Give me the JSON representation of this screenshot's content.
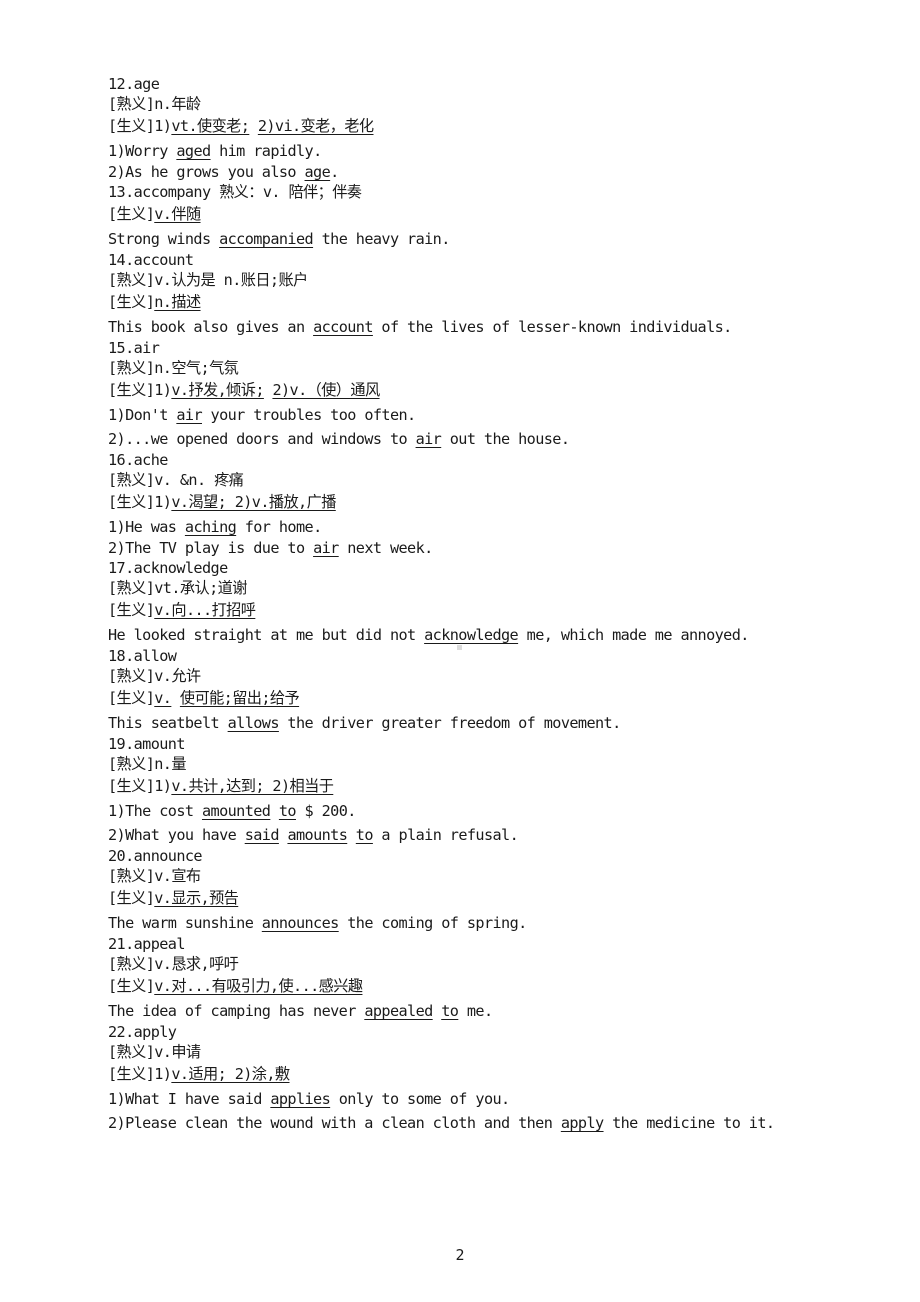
{
  "document": {
    "page_number": "2",
    "lines": [
      {
        "type": "head",
        "segs": [
          {
            "t": "12.age"
          }
        ]
      },
      {
        "type": "head",
        "segs": [
          {
            "t": "[熟义]n.年龄"
          }
        ]
      },
      {
        "type": "gloss",
        "segs": [
          {
            "t": "[生义]1)"
          },
          {
            "t": "vt.使变老;",
            "u": true
          },
          {
            "t": " "
          },
          {
            "t": "2)vi.变老，老化",
            "u": true
          }
        ]
      },
      {
        "type": "sent",
        "segs": [
          {
            "t": "1)Worry "
          },
          {
            "t": "aged",
            "u": true
          },
          {
            "t": " him rapidly."
          }
        ]
      },
      {
        "type": "head",
        "segs": [
          {
            "t": "2)As he grows you also "
          },
          {
            "t": "age",
            "u": true
          },
          {
            "t": "."
          }
        ]
      },
      {
        "type": "head",
        "segs": [
          {
            "t": "13.accompany 熟义：v. 陪伴；伴奏"
          }
        ]
      },
      {
        "type": "gloss",
        "segs": [
          {
            "t": "[生义]"
          },
          {
            "t": "v.伴随",
            "u": true
          }
        ]
      },
      {
        "type": "sent",
        "segs": [
          {
            "t": "Strong winds "
          },
          {
            "t": "accompanied",
            "u": true
          },
          {
            "t": " the heavy rain."
          }
        ]
      },
      {
        "type": "head",
        "segs": [
          {
            "t": "14.account"
          }
        ]
      },
      {
        "type": "head",
        "segs": [
          {
            "t": "[熟义]v.认为是 n.账日;账户"
          }
        ]
      },
      {
        "type": "gloss",
        "segs": [
          {
            "t": "[生义]"
          },
          {
            "t": "n.描述",
            "u": true
          }
        ]
      },
      {
        "type": "sent",
        "segs": [
          {
            "t": "This book also gives an "
          },
          {
            "t": "account",
            "u": true
          },
          {
            "t": " of the lives of lesser-known individuals."
          }
        ]
      },
      {
        "type": "head",
        "segs": [
          {
            "t": "15.air"
          }
        ]
      },
      {
        "type": "head",
        "segs": [
          {
            "t": "[熟义]n.空气;气氛"
          }
        ]
      },
      {
        "type": "gloss",
        "segs": [
          {
            "t": "[生义]1)"
          },
          {
            "t": "v.抒发,倾诉;",
            "u": true
          },
          {
            "t": " "
          },
          {
            "t": "2)v.（使）通风",
            "u": true
          }
        ]
      },
      {
        "type": "sent",
        "segs": [
          {
            "t": "1)Don't "
          },
          {
            "t": "air",
            "u": true
          },
          {
            "t": " your troubles too often."
          }
        ]
      },
      {
        "type": "sent",
        "segs": [
          {
            "t": "2)...we opened doors and windows to "
          },
          {
            "t": "air",
            "u": true
          },
          {
            "t": " out the house."
          }
        ]
      },
      {
        "type": "head",
        "segs": [
          {
            "t": "16.ache"
          }
        ]
      },
      {
        "type": "head",
        "segs": [
          {
            "t": "[熟义]v. &n. 疼痛"
          }
        ]
      },
      {
        "type": "gloss",
        "segs": [
          {
            "t": "[生义]1)"
          },
          {
            "t": "v.渴望; 2)v.播放,广播",
            "u": true
          }
        ]
      },
      {
        "type": "sent",
        "segs": [
          {
            "t": "1)He was "
          },
          {
            "t": "aching",
            "u": true
          },
          {
            "t": " for home."
          }
        ]
      },
      {
        "type": "head",
        "segs": [
          {
            "t": "2)The TV play is due to "
          },
          {
            "t": "air",
            "u": true
          },
          {
            "t": " next week."
          }
        ]
      },
      {
        "type": "head",
        "segs": [
          {
            "t": "17.acknowledge"
          }
        ]
      },
      {
        "type": "head",
        "segs": [
          {
            "t": "[熟义]vt.承认;道谢"
          }
        ]
      },
      {
        "type": "gloss",
        "segs": [
          {
            "t": "[生义]"
          },
          {
            "t": "v.向...打招呼",
            "u": true
          }
        ]
      },
      {
        "type": "sent",
        "segs": [
          {
            "t": "He looked straight at me but did not "
          },
          {
            "t": "acknowledge",
            "u": true
          },
          {
            "t": " me, which made me annoyed."
          }
        ]
      },
      {
        "type": "head",
        "segs": [
          {
            "t": "18.allow"
          }
        ]
      },
      {
        "type": "head",
        "segs": [
          {
            "t": "[熟义]v.允许"
          }
        ]
      },
      {
        "type": "gloss",
        "segs": [
          {
            "t": "[生义]"
          },
          {
            "t": "v.",
            "u": true
          },
          {
            "t": " "
          },
          {
            "t": "使可能;留出;给予",
            "u": true
          }
        ]
      },
      {
        "type": "sent",
        "segs": [
          {
            "t": "This seatbelt "
          },
          {
            "t": "allows",
            "u": true
          },
          {
            "t": " the driver greater freedom of movement."
          }
        ]
      },
      {
        "type": "head",
        "segs": [
          {
            "t": "19.amount"
          }
        ]
      },
      {
        "type": "head",
        "segs": [
          {
            "t": "[熟义]n.量"
          }
        ]
      },
      {
        "type": "gloss",
        "segs": [
          {
            "t": "[生义]1)"
          },
          {
            "t": "v.共计,达到; 2)相当于",
            "u": true
          }
        ]
      },
      {
        "type": "sent",
        "segs": [
          {
            "t": "1)The cost "
          },
          {
            "t": "amounted",
            "u": true
          },
          {
            "t": " "
          },
          {
            "t": "to",
            "u": true
          },
          {
            "t": " $ 200."
          }
        ]
      },
      {
        "type": "sent",
        "segs": [
          {
            "t": "2)What you have "
          },
          {
            "t": "said",
            "u": true
          },
          {
            "t": " "
          },
          {
            "t": "amounts",
            "u": true
          },
          {
            "t": " "
          },
          {
            "t": "to",
            "u": true
          },
          {
            "t": " a plain refusal."
          }
        ]
      },
      {
        "type": "head",
        "segs": [
          {
            "t": "20.announce"
          }
        ]
      },
      {
        "type": "head",
        "segs": [
          {
            "t": "[熟义]v.宣布"
          }
        ]
      },
      {
        "type": "gloss",
        "segs": [
          {
            "t": "[生义]"
          },
          {
            "t": "v.显示,预告",
            "u": true
          }
        ]
      },
      {
        "type": "sent",
        "segs": [
          {
            "t": "The warm sunshine "
          },
          {
            "t": "announces",
            "u": true
          },
          {
            "t": " the coming of spring."
          }
        ]
      },
      {
        "type": "head",
        "segs": [
          {
            "t": "21.appeal"
          }
        ]
      },
      {
        "type": "head",
        "segs": [
          {
            "t": "[熟义]v.恳求,呼吁"
          }
        ]
      },
      {
        "type": "gloss",
        "segs": [
          {
            "t": "[生义]"
          },
          {
            "t": "v.对...有吸引力,使...感兴趣",
            "u": true
          }
        ]
      },
      {
        "type": "sent",
        "segs": [
          {
            "t": "The idea of camping has never "
          },
          {
            "t": "appealed",
            "u": true
          },
          {
            "t": " "
          },
          {
            "t": "to",
            "u": true
          },
          {
            "t": " me."
          }
        ]
      },
      {
        "type": "head",
        "segs": [
          {
            "t": "22.apply"
          }
        ]
      },
      {
        "type": "head",
        "segs": [
          {
            "t": "[熟义]v.申请"
          }
        ]
      },
      {
        "type": "gloss",
        "segs": [
          {
            "t": "[生义]1)"
          },
          {
            "t": "v.适用; 2)涂,敷",
            "u": true
          }
        ]
      },
      {
        "type": "sent",
        "segs": [
          {
            "t": "1)What I have said "
          },
          {
            "t": "applies",
            "u": true
          },
          {
            "t": " only to some of you."
          }
        ]
      },
      {
        "type": "sent",
        "segs": [
          {
            "t": "2)Please clean the wound with a clean cloth and then "
          },
          {
            "t": "apply",
            "u": true
          },
          {
            "t": " the medicine to it."
          }
        ]
      }
    ]
  }
}
